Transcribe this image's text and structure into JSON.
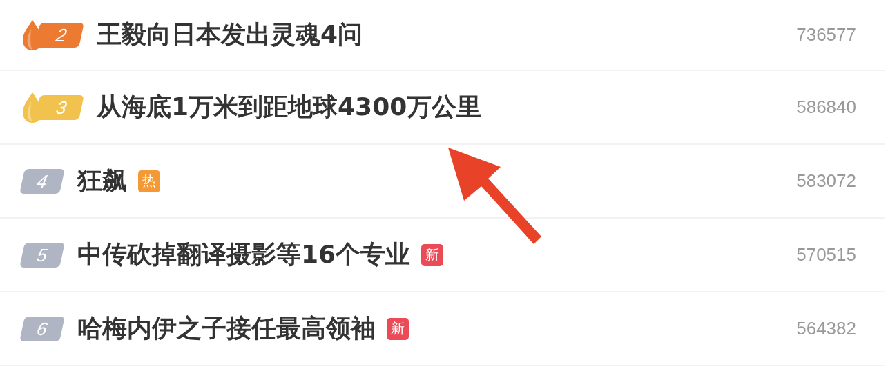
{
  "rows": [
    {
      "rank": "2",
      "kind": "fire",
      "color": "#ec7a30",
      "title": "王毅向日本发出灵魂4问",
      "count": "736577"
    },
    {
      "rank": "3",
      "kind": "fire",
      "color": "#f2c24e",
      "title": "从海底1万米到距地球4300万公里",
      "count": "586840"
    },
    {
      "rank": "4",
      "kind": "plain",
      "color": "#b0b5c4",
      "title": "狂飙",
      "tag": {
        "kind": "hot",
        "text": "热"
      },
      "count": "583072"
    },
    {
      "rank": "5",
      "kind": "plain",
      "color": "#b0b5c4",
      "title": "中传砍掉翻译摄影等16个专业",
      "tag": {
        "kind": "new",
        "text": "新"
      },
      "count": "570515"
    },
    {
      "rank": "6",
      "kind": "plain",
      "color": "#b0b5c4",
      "title": "哈梅内伊之子接任最高领袖",
      "tag": {
        "kind": "new",
        "text": "新"
      },
      "count": "564382"
    }
  ]
}
